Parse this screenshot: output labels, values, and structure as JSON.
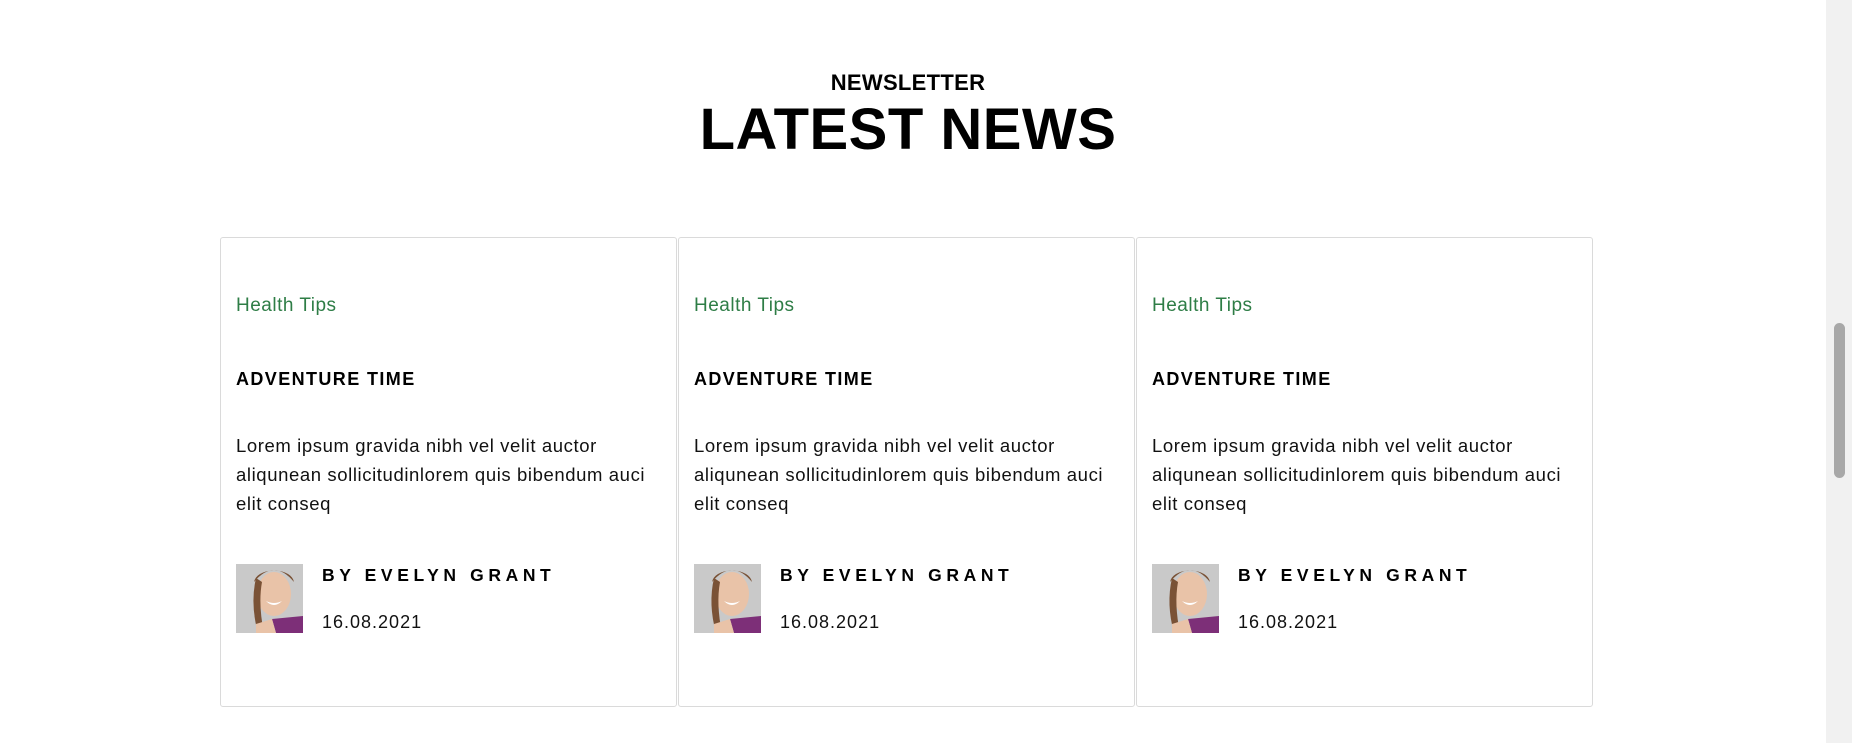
{
  "section": {
    "eyebrow": "NEWSLETTER",
    "heading": "LATEST NEWS"
  },
  "cards": [
    {
      "category": "Health Tips",
      "title": "ADVENTURE TIME",
      "description": "Lorem ipsum gravida nibh vel velit auctor aliqunean sollicitudinlorem quis bibendum auci elit conseq",
      "author": "BY EVELYN GRANT",
      "date": "16.08.2021"
    },
    {
      "category": "Health Tips",
      "title": "ADVENTURE TIME",
      "description": "Lorem ipsum gravida nibh vel velit auctor aliqunean sollicitudinlorem quis bibendum auci elit conseq",
      "author": "BY EVELYN GRANT",
      "date": "16.08.2021"
    },
    {
      "category": "Health Tips",
      "title": "ADVENTURE TIME",
      "description": "Lorem ipsum gravida nibh vel velit auctor aliqunean sollicitudinlorem quis bibendum auci elit conseq",
      "author": "BY EVELYN GRANT",
      "date": "16.08.2021"
    }
  ],
  "colors": {
    "category": "#2e7d46",
    "card_border": "#dadada",
    "scroll_thumb": "#a8a8a8"
  },
  "scrollbar": {
    "position_fraction": 0.55
  }
}
